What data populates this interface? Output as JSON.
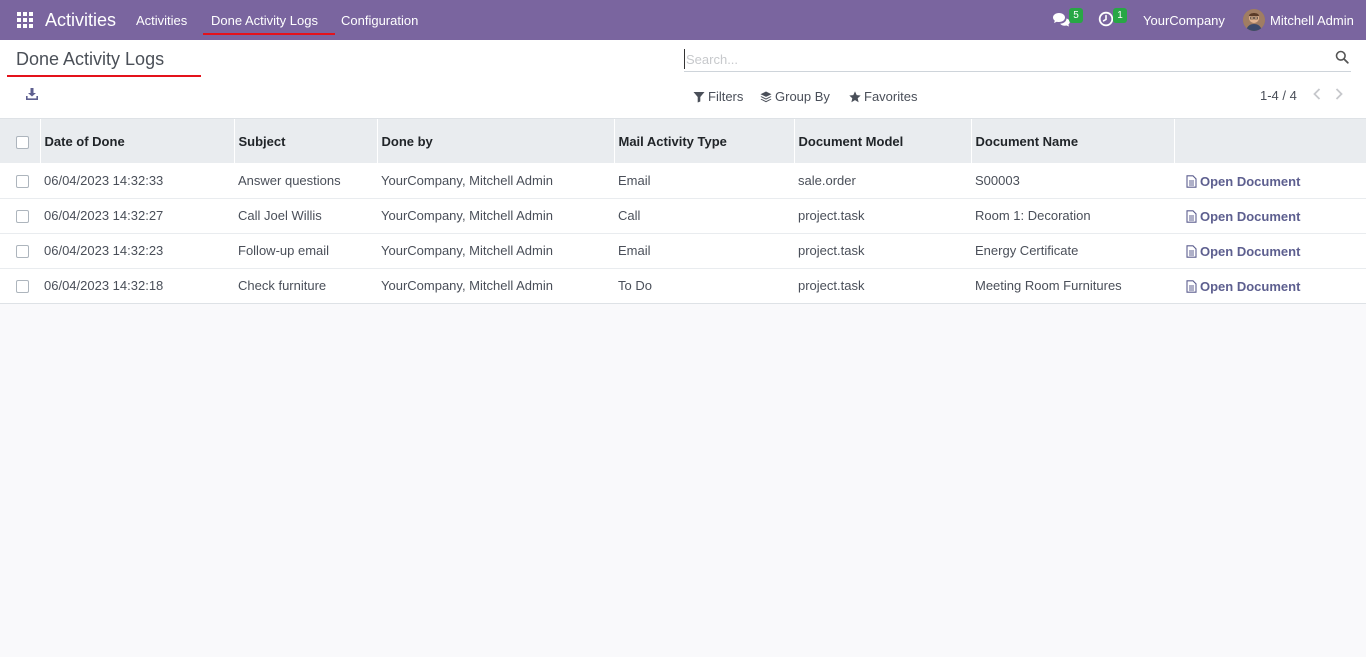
{
  "navbar": {
    "brand": "Activities",
    "menu": [
      {
        "label": "Activities"
      },
      {
        "label": "Done Activity Logs"
      },
      {
        "label": "Configuration"
      }
    ],
    "messages_count": "5",
    "activities_count": "1",
    "company": "YourCompany",
    "user": "Mitchell Admin"
  },
  "control_panel": {
    "title": "Done Activity Logs",
    "search_placeholder": "Search...",
    "filters_label": "Filters",
    "group_by_label": "Group By",
    "favorites_label": "Favorites",
    "pager": "1-4 / 4"
  },
  "table": {
    "headers": [
      "Date of Done",
      "Subject",
      "Done by",
      "Mail Activity Type",
      "Document Model",
      "Document Name"
    ],
    "action_label": "Open Document",
    "rows": [
      {
        "date": "06/04/2023 14:32:33",
        "subject": "Answer questions",
        "done_by": "YourCompany, Mitchell Admin",
        "type": "Email",
        "model": "sale.order",
        "name": "S00003"
      },
      {
        "date": "06/04/2023 14:32:27",
        "subject": "Call Joel Willis",
        "done_by": "YourCompany, Mitchell Admin",
        "type": "Call",
        "model": "project.task",
        "name": "Room 1: Decoration"
      },
      {
        "date": "06/04/2023 14:32:23",
        "subject": "Follow-up email",
        "done_by": "YourCompany, Mitchell Admin",
        "type": "Email",
        "model": "project.task",
        "name": "Energy Certificate"
      },
      {
        "date": "06/04/2023 14:32:18",
        "subject": "Check furniture",
        "done_by": "YourCompany, Mitchell Admin",
        "type": "To Do",
        "model": "project.task",
        "name": "Meeting Room Furnitures"
      }
    ]
  },
  "colors": {
    "navbar": "#7a659f",
    "highlight": "#e4121b",
    "badge": "#28a745",
    "link": "#5d5f8f"
  }
}
